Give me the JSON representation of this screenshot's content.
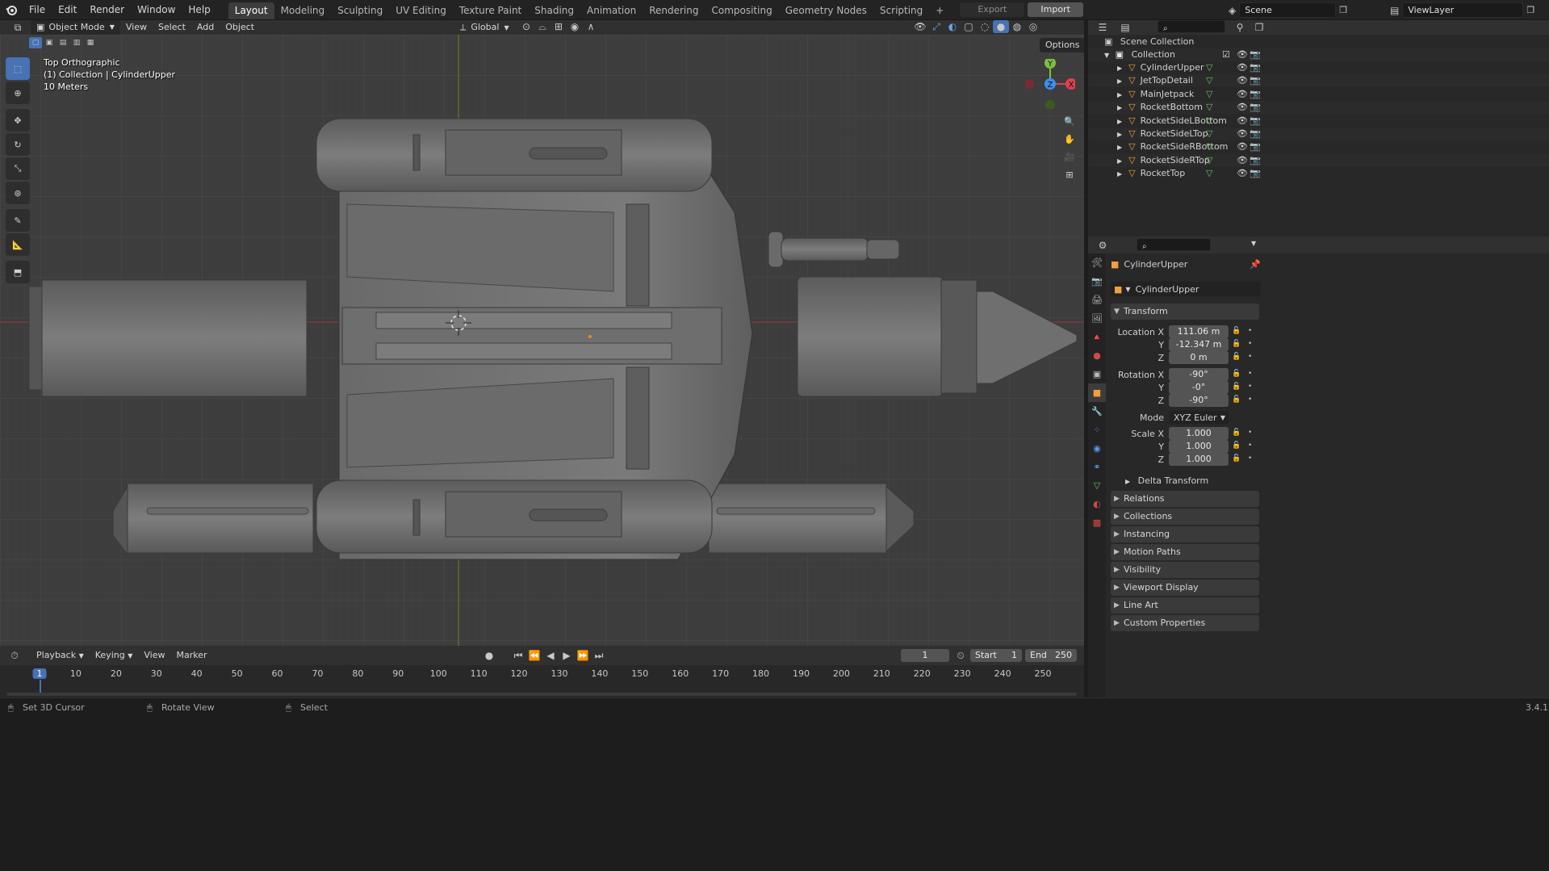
{
  "topbar": {
    "menus": [
      "File",
      "Edit",
      "Render",
      "Window",
      "Help"
    ],
    "workspaces": [
      "Layout",
      "Modeling",
      "Sculpting",
      "UV Editing",
      "Texture Paint",
      "Shading",
      "Animation",
      "Rendering",
      "Compositing",
      "Geometry Nodes",
      "Scripting"
    ],
    "add_workspace": "+",
    "export_label": "Export",
    "import_label": "Import",
    "scene_name": "Scene",
    "view_layer": "ViewLayer"
  },
  "viewport_header": {
    "mode": "Object Mode",
    "menus": [
      "View",
      "Select",
      "Add",
      "Object"
    ],
    "transform_orientation": "Global",
    "options_label": "Options"
  },
  "viewport": {
    "view_name": "Top Orthographic",
    "collection_path": "(1) Collection | CylinderUpper",
    "scale_text": "10 Meters",
    "gizmo": {
      "x": "X",
      "y": "Y",
      "z": "Z"
    },
    "colors": {
      "x_axis": "#e04050",
      "y_axis": "#7fbf3f",
      "z_axis": "#3d8ef0",
      "accent": "#4772b3"
    }
  },
  "outliner": {
    "root": "Scene Collection",
    "collection": "Collection",
    "objects": [
      "CylinderUpper",
      "JetTopDetail",
      "MainJetpack",
      "RocketBottom",
      "RocketSideLBottom",
      "RocketSideLTop",
      "RocketSideRBottom",
      "RocketSideRTop",
      "RocketTop"
    ]
  },
  "properties": {
    "object_name": "CylinderUpper",
    "object_data_name": "CylinderUpper",
    "transform_label": "Transform",
    "location_label": "Location X",
    "rotation_label": "Rotation X",
    "scale_label": "Scale X",
    "axis_y": "Y",
    "axis_z": "Z",
    "location": [
      "111.06 m",
      "-12.347 m",
      "0 m"
    ],
    "rotation": [
      "-90°",
      "-0°",
      "-90°"
    ],
    "mode_label": "Mode",
    "mode_value": "XYZ Euler",
    "scale": [
      "1.000",
      "1.000",
      "1.000"
    ],
    "panels": [
      "Delta Transform",
      "Relations",
      "Collections",
      "Instancing",
      "Motion Paths",
      "Visibility",
      "Viewport Display",
      "Line Art",
      "Custom Properties"
    ]
  },
  "timeline": {
    "menus": [
      "Playback",
      "Keying",
      "View",
      "Marker"
    ],
    "current_frame": "1",
    "start_label": "Start",
    "start_value": "1",
    "end_label": "End",
    "end_value": "250",
    "ruler": [
      "1",
      "10",
      "20",
      "30",
      "40",
      "50",
      "60",
      "70",
      "80",
      "90",
      "100",
      "110",
      "120",
      "130",
      "140",
      "150",
      "160",
      "170",
      "180",
      "190",
      "200",
      "210",
      "220",
      "230",
      "240",
      "250"
    ]
  },
  "statusbar": {
    "items": [
      "Set 3D Cursor",
      "Rotate View",
      "Select"
    ],
    "version": "3.4.1"
  }
}
